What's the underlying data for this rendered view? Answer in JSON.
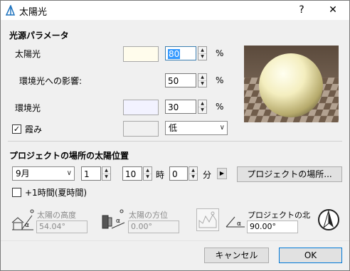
{
  "window": {
    "title": "太陽光",
    "help": "?",
    "close": "✕"
  },
  "light_params": {
    "section_title": "光源パラメータ",
    "sun_label": "太陽光",
    "sun_value": "80",
    "ambient_label": "環境光への影響:",
    "ambient_value": "50",
    "env_label": "環境光",
    "env_value": "30",
    "shadow_label": "霞み",
    "shadow_checked": true,
    "shadow_quality": "低",
    "percent": "%"
  },
  "sun_position": {
    "section_title": "プロジェクトの場所の太陽位置",
    "month": "9月",
    "day": "1",
    "hour": "10",
    "hour_unit": "時",
    "minute": "0",
    "minute_unit": "分",
    "location_button": "プロジェクトの場所...",
    "dst_label": "+1時間(夏時間)",
    "altitude_label": "太陽の高度",
    "altitude_value": "54.04°",
    "azimuth_label": "太陽の方位",
    "azimuth_value": "0.00°",
    "north_label": "プロジェクトの北",
    "north_value": "90.00°"
  },
  "buttons": {
    "cancel": "キャンセル",
    "ok": "OK"
  },
  "colors": {
    "sun_swatch": "#fffcec",
    "env_swatch": "#f2f2ff",
    "shadow_swatch": "#f0f0f0",
    "accent": "#3399ff"
  }
}
